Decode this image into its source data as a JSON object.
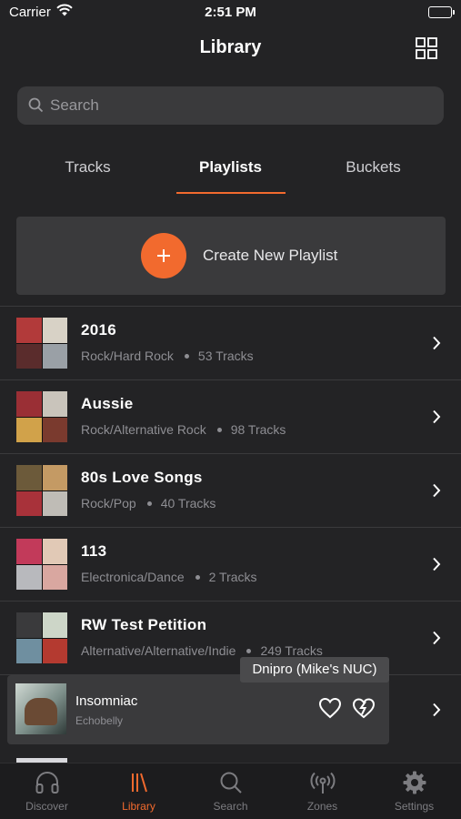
{
  "status_bar": {
    "carrier": "Carrier",
    "time": "2:51 PM"
  },
  "nav": {
    "title": "Library",
    "grid_icon": "grid-icon"
  },
  "search": {
    "placeholder": "Search"
  },
  "tabs": [
    {
      "label": "Tracks",
      "active": false
    },
    {
      "label": "Playlists",
      "active": true
    },
    {
      "label": "Buckets",
      "active": false
    }
  ],
  "create": {
    "label": "Create New Playlist"
  },
  "playlists": [
    {
      "title": "2016",
      "genre": "Rock/Hard Rock",
      "tracks": "53 Tracks"
    },
    {
      "title": "Aussie",
      "genre": "Rock/Alternative Rock",
      "tracks": "98 Tracks"
    },
    {
      "title": "80s Love Songs",
      "genre": "Rock/Pop",
      "tracks": "40 Tracks"
    },
    {
      "title": "113",
      "genre": "Electronica/Dance",
      "tracks": "2 Tracks"
    },
    {
      "title": "RW Test Petition",
      "genre": "Alternative/Alternative/Indie",
      "tracks": "249 Tracks"
    }
  ],
  "now_playing": {
    "title": "Insomniac",
    "artist": "Echobelly",
    "zone": "Dnipro (Mike's NUC)"
  },
  "tabbar": [
    {
      "label": "Discover",
      "icon": "headphones-icon",
      "active": false
    },
    {
      "label": "Library",
      "icon": "library-icon",
      "active": true
    },
    {
      "label": "Search",
      "icon": "search-icon",
      "active": false
    },
    {
      "label": "Zones",
      "icon": "broadcast-icon",
      "active": false
    },
    {
      "label": "Settings",
      "icon": "gear-icon",
      "active": false
    }
  ],
  "colors": {
    "accent": "#f26a2e",
    "background": "#232325",
    "card": "#3a3a3c"
  }
}
